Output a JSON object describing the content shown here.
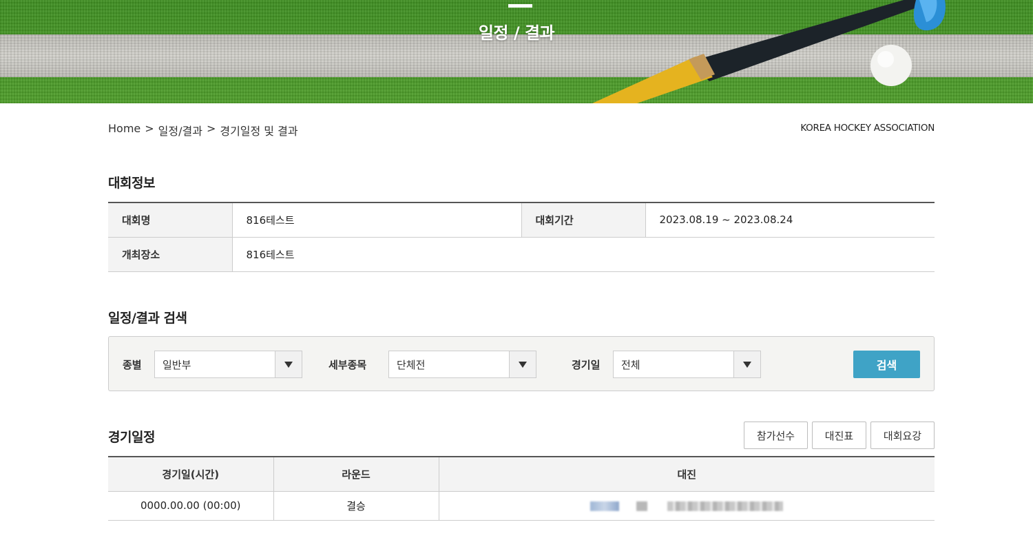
{
  "hero": {
    "title": "일정 / 결과"
  },
  "breadcrumb": {
    "home": "Home",
    "level1": "일정/결과",
    "level2": "경기일정 및 결과",
    "separator": ">"
  },
  "org_label": "KOREA HOCKEY ASSOCIATION",
  "tournament_info": {
    "section_title": "대회정보",
    "name_label": "대회명",
    "name_value": "816테스트",
    "period_label": "대회기간",
    "period_value": "2023.08.19 ~ 2023.08.24",
    "venue_label": "개최장소",
    "venue_value": "816테스트"
  },
  "search": {
    "section_title": "일정/결과 검색",
    "category_label": "종별",
    "category_value": "일반부",
    "event_label": "세부종목",
    "event_value": "단체전",
    "date_label": "경기일",
    "date_value": "전체",
    "button_label": "검색",
    "button_color": "#3fa3c6"
  },
  "schedule": {
    "section_title": "경기일정",
    "buttons": {
      "players": "참가선수",
      "bracket": "대진표",
      "guide": "대회요강"
    },
    "columns": [
      "경기일(시간)",
      "라운드",
      "대진"
    ],
    "rows": [
      {
        "date_time": "0000.00.00 (00:00)",
        "round": "결승"
      }
    ]
  }
}
